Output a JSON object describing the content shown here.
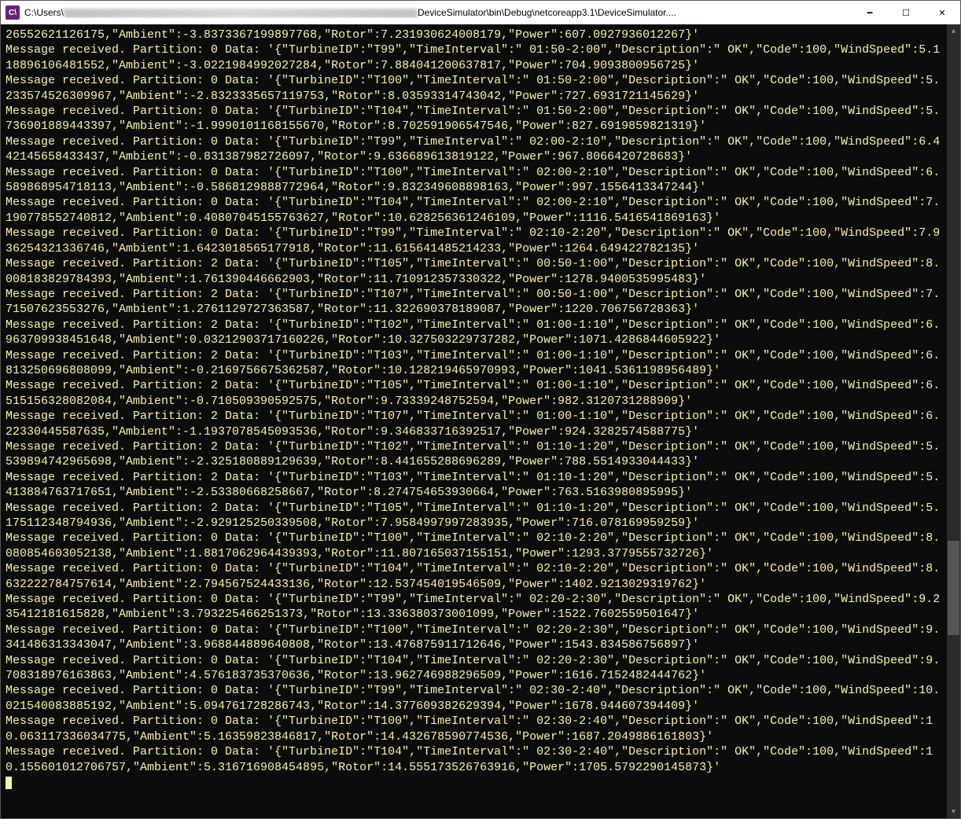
{
  "window": {
    "icon_text": "C\\",
    "title_prefix": "C:\\Users\\",
    "title_suffix": "DeviceSimulator\\bin\\Debug\\netcoreapp3.1\\DeviceSimulator....",
    "minimize_glyph": "━",
    "maximize_glyph": "☐",
    "close_glyph": "✕"
  },
  "first_line_tail": "26552621126175,\"Ambient\":-3.8373367199897768,\"Rotor\":7.231930624008179,\"Power\":607.0927936012267}'",
  "messages": [
    {
      "partition": 0,
      "TurbineID": "T99",
      "TimeInterval": " 01:50-2:00",
      "Description": " OK",
      "Code": 100,
      "WindSpeed": "5.118896106481552",
      "Ambient": "-3.0221984992027284",
      "Rotor": "7.884041200637817",
      "Power": "704.9093800956725"
    },
    {
      "partition": 0,
      "TurbineID": "T100",
      "TimeInterval": " 01:50-2:00",
      "Description": " OK",
      "Code": 100,
      "WindSpeed": "5.233574526309967",
      "Ambient": "-2.8323335657119753",
      "Rotor": "8.03593314743042",
      "Power": "727.6931721145629"
    },
    {
      "partition": 0,
      "TurbineID": "T104",
      "TimeInterval": " 01:50-2:00",
      "Description": " OK",
      "Code": 100,
      "WindSpeed": "5.736901889443397",
      "Ambient": "-1.9990101168155670",
      "Rotor": "8.702591906547546",
      "Power": "827.6919859821319"
    },
    {
      "partition": 0,
      "TurbineID": "T99",
      "TimeInterval": " 02:00-2:10",
      "Description": " OK",
      "Code": 100,
      "WindSpeed": "6.442145658433437",
      "Ambient": "-0.831387982726097",
      "Rotor": "9.636689613819122",
      "Power": "967.8066420728683"
    },
    {
      "partition": 0,
      "TurbineID": "T100",
      "TimeInterval": " 02:00-2:10",
      "Description": " OK",
      "Code": 100,
      "WindSpeed": "6.589868954718113",
      "Ambient": "-0.5868129888772964",
      "Rotor": "9.832349608898163",
      "Power": "997.1556413347244"
    },
    {
      "partition": 0,
      "TurbineID": "T104",
      "TimeInterval": " 02:00-2:10",
      "Description": " OK",
      "Code": 100,
      "WindSpeed": "7.190778552740812",
      "Ambient": "0.40807045155763627",
      "Rotor": "10.628256361246109",
      "Power": "1116.5416541869163"
    },
    {
      "partition": 0,
      "TurbineID": "T99",
      "TimeInterval": " 02:10-2:20",
      "Description": " OK",
      "Code": 100,
      "WindSpeed": "7.936254321336746",
      "Ambient": "1.6423018565177918",
      "Rotor": "11.615641485214233",
      "Power": "1264.649422782135"
    },
    {
      "partition": 2,
      "TurbineID": "T105",
      "TimeInterval": " 00:50-1:00",
      "Description": " OK",
      "Code": 100,
      "WindSpeed": "8.008183829784393",
      "Ambient": "1.761390446662903",
      "Rotor": "11.710912357330322",
      "Power": "1278.9400535995483"
    },
    {
      "partition": 2,
      "TurbineID": "T107",
      "TimeInterval": " 00:50-1:00",
      "Description": " OK",
      "Code": 100,
      "WindSpeed": "7.71507623553276",
      "Ambient": "1.2761129727363587",
      "Rotor": "11.322690378189087",
      "Power": "1220.706756728363"
    },
    {
      "partition": 2,
      "TurbineID": "T102",
      "TimeInterval": " 01:00-1:10",
      "Description": " OK",
      "Code": 100,
      "WindSpeed": "6.963709938451648",
      "Ambient": "0.03212903717160226",
      "Rotor": "10.327503229737282",
      "Power": "1071.4286844605922"
    },
    {
      "partition": 2,
      "TurbineID": "T103",
      "TimeInterval": " 01:00-1:10",
      "Description": " OK",
      "Code": 100,
      "WindSpeed": "6.813250696808099",
      "Ambient": "-0.2169756675362587",
      "Rotor": "10.128219465970993",
      "Power": "1041.5361198956489"
    },
    {
      "partition": 2,
      "TurbineID": "T105",
      "TimeInterval": " 01:00-1:10",
      "Description": " OK",
      "Code": 100,
      "WindSpeed": "6.515156328082084",
      "Ambient": "-0.710509390592575",
      "Rotor": "9.73339248752594",
      "Power": "982.3120731288909"
    },
    {
      "partition": 2,
      "TurbineID": "T107",
      "TimeInterval": " 01:00-1:10",
      "Description": " OK",
      "Code": 100,
      "WindSpeed": "6.22330445587635",
      "Ambient": "-1.1937078545093536",
      "Rotor": "9.346833716392517",
      "Power": "924.3282574588775"
    },
    {
      "partition": 2,
      "TurbineID": "T102",
      "TimeInterval": " 01:10-1:20",
      "Description": " OK",
      "Code": 100,
      "WindSpeed": "5.539894742965698",
      "Ambient": "-2.325180889129639",
      "Rotor": "8.441655288696289",
      "Power": "788.5514933044433"
    },
    {
      "partition": 2,
      "TurbineID": "T103",
      "TimeInterval": " 01:10-1:20",
      "Description": " OK",
      "Code": 100,
      "WindSpeed": "5.413884763717651",
      "Ambient": "-2.53380668258667",
      "Rotor": "8.274754653930664",
      "Power": "763.5163980895995"
    },
    {
      "partition": 2,
      "TurbineID": "T105",
      "TimeInterval": " 01:10-1:20",
      "Description": " OK",
      "Code": 100,
      "WindSpeed": "5.175112348794936",
      "Ambient": "-2.929125250339508",
      "Rotor": "7.9584997997283935",
      "Power": "716.078169959259"
    },
    {
      "partition": 0,
      "TurbineID": "T100",
      "TimeInterval": " 02:10-2:20",
      "Description": " OK",
      "Code": 100,
      "WindSpeed": "8.080854603052138",
      "Ambient": "1.8817062964439393",
      "Rotor": "11.807165037155151",
      "Power": "1293.3779555732726"
    },
    {
      "partition": 0,
      "TurbineID": "T104",
      "TimeInterval": " 02:10-2:20",
      "Description": " OK",
      "Code": 100,
      "WindSpeed": "8.632222784757614",
      "Ambient": "2.794567524433136",
      "Rotor": "12.537454019546509",
      "Power": "1402.9213029319762"
    },
    {
      "partition": 0,
      "TurbineID": "T99",
      "TimeInterval": " 02:20-2:30",
      "Description": " OK",
      "Code": 100,
      "WindSpeed": "9.235412181615828",
      "Ambient": "3.793225466251373",
      "Rotor": "13.336380373001099",
      "Power": "1522.7602559501647"
    },
    {
      "partition": 0,
      "TurbineID": "T100",
      "TimeInterval": " 02:20-2:30",
      "Description": " OK",
      "Code": 100,
      "WindSpeed": "9.341486313343047",
      "Ambient": "3.968844889640808",
      "Rotor": "13.476875911712646",
      "Power": "1543.834586756897"
    },
    {
      "partition": 0,
      "TurbineID": "T104",
      "TimeInterval": " 02:20-2:30",
      "Description": " OK",
      "Code": 100,
      "WindSpeed": "9.708318976163863",
      "Ambient": "4.576183735370636",
      "Rotor": "13.962746988296509",
      "Power": "1616.7152482444762"
    },
    {
      "partition": 0,
      "TurbineID": "T99",
      "TimeInterval": " 02:30-2:40",
      "Description": " OK",
      "Code": 100,
      "WindSpeed": "10.021540083885192",
      "Ambient": "5.094761728286743",
      "Rotor": "14.377609382629394",
      "Power": "1678.944607394409"
    },
    {
      "partition": 0,
      "TurbineID": "T100",
      "TimeInterval": " 02:30-2:40",
      "Description": " OK",
      "Code": 100,
      "WindSpeed": "10.063117336034775",
      "Ambient": "5.16359823846817",
      "Rotor": "14.432678590774536",
      "Power": "1687.2049886161803"
    },
    {
      "partition": 0,
      "TurbineID": "T104",
      "TimeInterval": " 02:30-2:40",
      "Description": " OK",
      "Code": 100,
      "WindSpeed": "10.155601012706757",
      "Ambient": "5.316716908454895",
      "Rotor": "14.555173526763916",
      "Power": "1705.5792290145873"
    }
  ]
}
